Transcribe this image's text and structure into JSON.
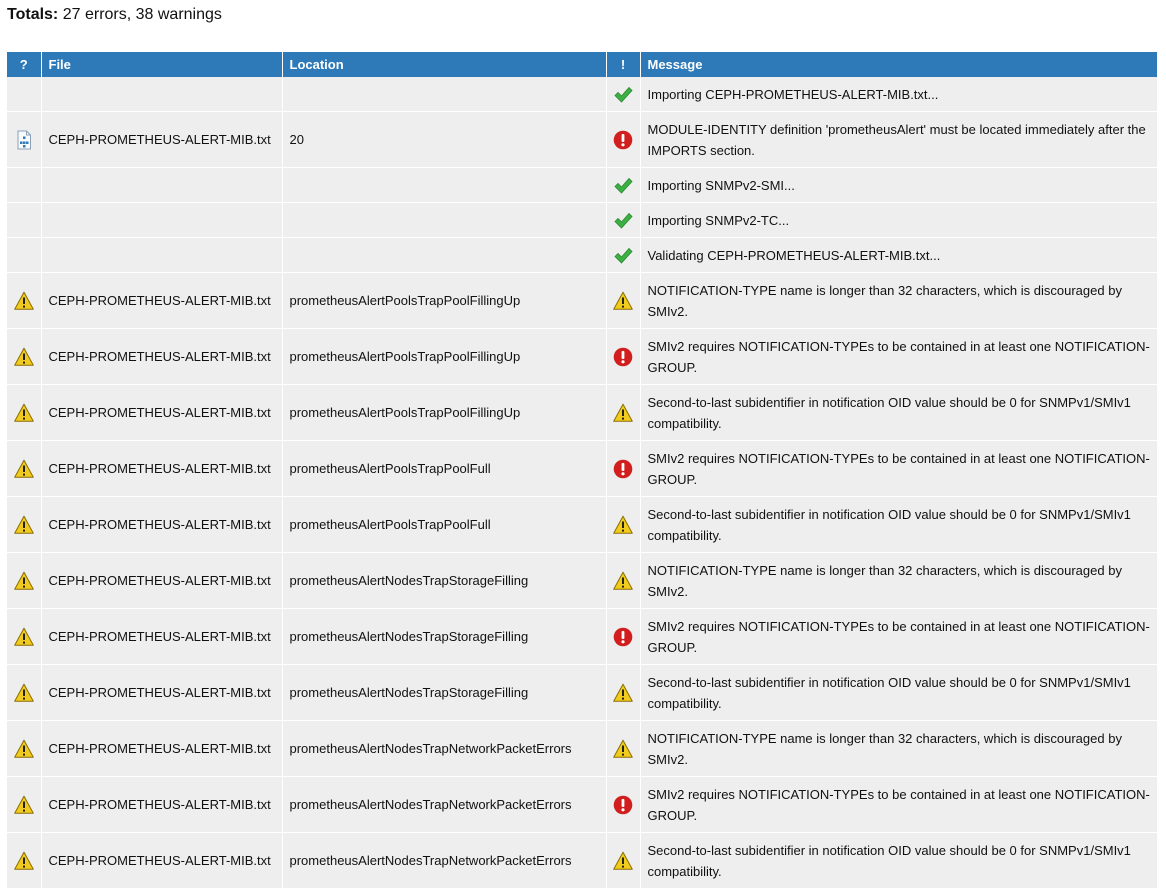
{
  "totals": {
    "label": "Totals:",
    "text": "27 errors, 38 warnings"
  },
  "columns": {
    "type": "?",
    "file": "File",
    "location": "Location",
    "severity": "!",
    "message": "Message"
  },
  "colors": {
    "header_bg": "#2e7ab8",
    "row_bg": "#eeeeee",
    "ok": "#3cb043",
    "error": "#d11f1f",
    "warning": "#f2cc1c"
  },
  "rows": [
    {
      "type_icon": "",
      "file": "",
      "location": "",
      "severity": "ok",
      "message": "Importing CEPH-PROMETHEUS-ALERT-MIB.txt..."
    },
    {
      "type_icon": "mib-file",
      "file": "CEPH-PROMETHEUS-ALERT-MIB.txt",
      "location": "20",
      "severity": "error",
      "message": "MODULE-IDENTITY definition 'prometheusAlert' must be located immediately after the IMPORTS section."
    },
    {
      "type_icon": "",
      "file": "",
      "location": "",
      "severity": "ok",
      "message": "Importing SNMPv2-SMI..."
    },
    {
      "type_icon": "",
      "file": "",
      "location": "",
      "severity": "ok",
      "message": "Importing SNMPv2-TC..."
    },
    {
      "type_icon": "",
      "file": "",
      "location": "",
      "severity": "ok",
      "message": "Validating CEPH-PROMETHEUS-ALERT-MIB.txt..."
    },
    {
      "type_icon": "warning",
      "file": "CEPH-PROMETHEUS-ALERT-MIB.txt",
      "location": "prometheusAlertPoolsTrapPoolFillingUp",
      "severity": "warning",
      "message": "NOTIFICATION-TYPE name is longer than 32 characters, which is discouraged by SMIv2."
    },
    {
      "type_icon": "warning",
      "file": "CEPH-PROMETHEUS-ALERT-MIB.txt",
      "location": "prometheusAlertPoolsTrapPoolFillingUp",
      "severity": "error",
      "message": "SMIv2 requires NOTIFICATION-TYPEs to be contained in at least one NOTIFICATION-GROUP."
    },
    {
      "type_icon": "warning",
      "file": "CEPH-PROMETHEUS-ALERT-MIB.txt",
      "location": "prometheusAlertPoolsTrapPoolFillingUp",
      "severity": "warning",
      "message": "Second-to-last subidentifier in notification OID value should be 0 for SNMPv1/SMIv1 compatibility."
    },
    {
      "type_icon": "warning",
      "file": "CEPH-PROMETHEUS-ALERT-MIB.txt",
      "location": "prometheusAlertPoolsTrapPoolFull",
      "severity": "error",
      "message": "SMIv2 requires NOTIFICATION-TYPEs to be contained in at least one NOTIFICATION-GROUP."
    },
    {
      "type_icon": "warning",
      "file": "CEPH-PROMETHEUS-ALERT-MIB.txt",
      "location": "prometheusAlertPoolsTrapPoolFull",
      "severity": "warning",
      "message": "Second-to-last subidentifier in notification OID value should be 0 for SNMPv1/SMIv1 compatibility."
    },
    {
      "type_icon": "warning",
      "file": "CEPH-PROMETHEUS-ALERT-MIB.txt",
      "location": "prometheusAlertNodesTrapStorageFilling",
      "severity": "warning",
      "message": "NOTIFICATION-TYPE name is longer than 32 characters, which is discouraged by SMIv2."
    },
    {
      "type_icon": "warning",
      "file": "CEPH-PROMETHEUS-ALERT-MIB.txt",
      "location": "prometheusAlertNodesTrapStorageFilling",
      "severity": "error",
      "message": "SMIv2 requires NOTIFICATION-TYPEs to be contained in at least one NOTIFICATION-GROUP."
    },
    {
      "type_icon": "warning",
      "file": "CEPH-PROMETHEUS-ALERT-MIB.txt",
      "location": "prometheusAlertNodesTrapStorageFilling",
      "severity": "warning",
      "message": "Second-to-last subidentifier in notification OID value should be 0 for SNMPv1/SMIv1 compatibility."
    },
    {
      "type_icon": "warning",
      "file": "CEPH-PROMETHEUS-ALERT-MIB.txt",
      "location": "prometheusAlertNodesTrapNetworkPacketErrors",
      "severity": "warning",
      "message": "NOTIFICATION-TYPE name is longer than 32 characters, which is discouraged by SMIv2."
    },
    {
      "type_icon": "warning",
      "file": "CEPH-PROMETHEUS-ALERT-MIB.txt",
      "location": "prometheusAlertNodesTrapNetworkPacketErrors",
      "severity": "error",
      "message": "SMIv2 requires NOTIFICATION-TYPEs to be contained in at least one NOTIFICATION-GROUP."
    },
    {
      "type_icon": "warning",
      "file": "CEPH-PROMETHEUS-ALERT-MIB.txt",
      "location": "prometheusAlertNodesTrapNetworkPacketErrors",
      "severity": "warning",
      "message": "Second-to-last subidentifier in notification OID value should be 0 for SNMPv1/SMIv1 compatibility."
    }
  ]
}
